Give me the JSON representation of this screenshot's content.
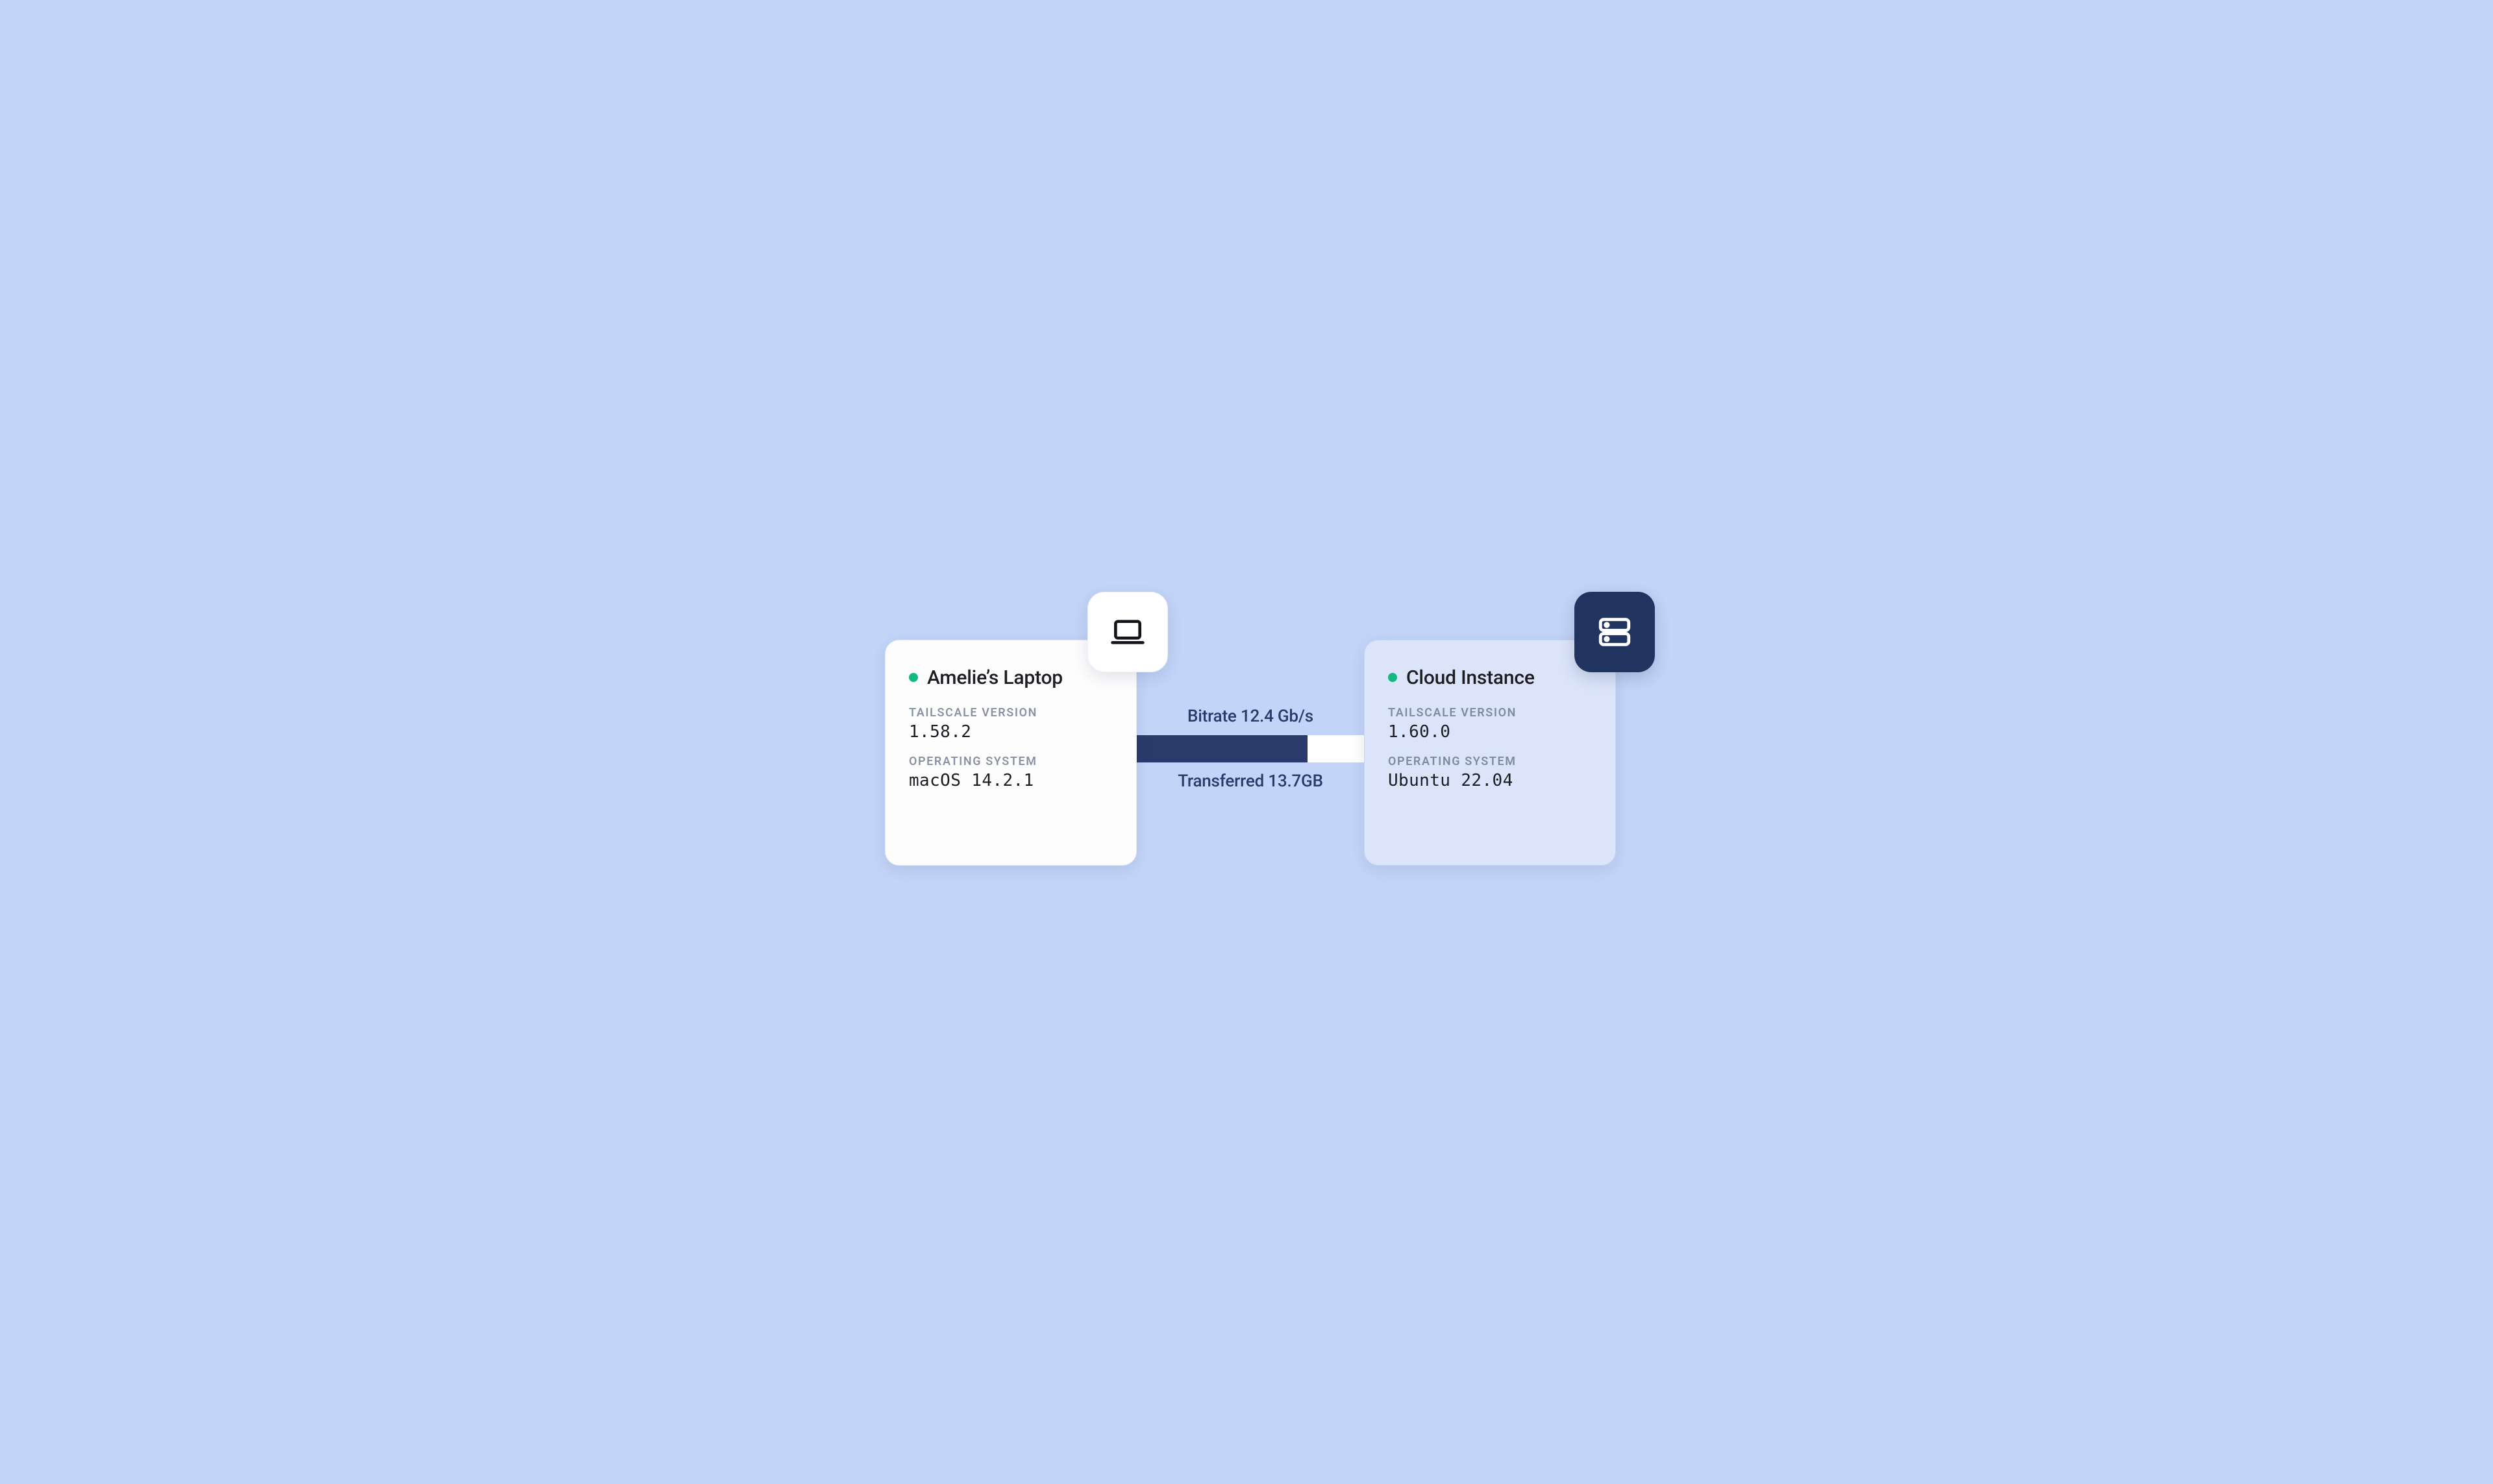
{
  "left": {
    "status": "online",
    "status_color": "#13b97f",
    "name": "Amelie’s Laptop",
    "version_label": "TAILSCALE VERSION",
    "version": "1.58.2",
    "os_label": "OPERATING SYSTEM",
    "os": "macOS 14.2.1",
    "icon": "laptop-icon"
  },
  "right": {
    "status": "online",
    "status_color": "#13b97f",
    "name": "Cloud Instance",
    "version_label": "TAILSCALE VERSION",
    "version": "1.60.0",
    "os_label": "OPERATING SYSTEM",
    "os": "Ubuntu 22.04",
    "icon": "server-icon"
  },
  "connection": {
    "bitrate_text": "Bitrate 12.4 Gb/s",
    "transferred_text": "Transferred 13.7GB",
    "progress_percent": 75
  },
  "colors": {
    "bg": "#c2d4f7",
    "accent_dark": "#2a3b6b",
    "badge_dark": "#21335f"
  }
}
